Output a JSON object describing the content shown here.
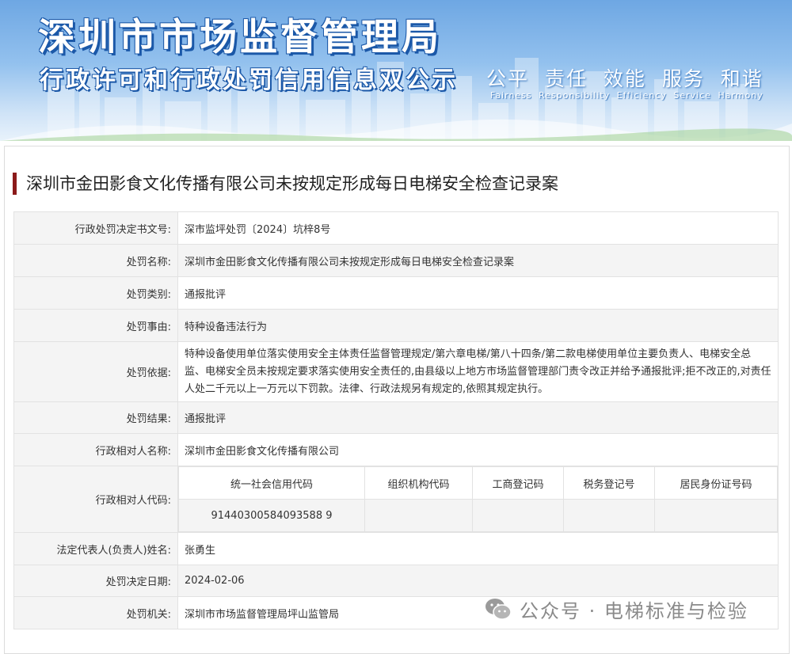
{
  "banner": {
    "title": "深圳市市场监督管理局",
    "subtitle": "行政许可和行政处罚信用信息双公示",
    "values": "公平 责任 效能 服务 和谐",
    "values_en": "Fairness Responsibility Efficiency Service Harmony"
  },
  "case_title": "深圳市金田影食文化传播有限公司未按规定形成每日电梯安全检查记录案",
  "fields": {
    "decision_no": {
      "label": "行政处罚决定书文号:",
      "value": "深市监坪处罚〔2024〕坑梓8号"
    },
    "penalty_name": {
      "label": "处罚名称:",
      "value": "深圳市金田影食文化传播有限公司未按规定形成每日电梯安全检查记录案"
    },
    "penalty_type": {
      "label": "处罚类别:",
      "value": "通报批评"
    },
    "penalty_reason": {
      "label": "处罚事由:",
      "value": "特种设备违法行为"
    },
    "penalty_basis": {
      "label": "处罚依据:",
      "value": "特种设备使用单位落实使用安全主体责任监督管理规定/第六章电梯/第八十四条/第二款电梯使用单位主要负责人、电梯安全总监、电梯安全员未按规定要求落实使用安全责任的,由县级以上地方市场监督管理部门责令改正并给予通报批评;拒不改正的,对责任人处二千元以上一万元以下罚款。法律、行政法规另有规定的,依照其规定执行。"
    },
    "penalty_result": {
      "label": "处罚结果:",
      "value": "通报批评"
    },
    "party_name": {
      "label": "行政相对人名称:",
      "value": "深圳市金田影食文化传播有限公司"
    },
    "party_code": {
      "label": "行政相对人代码:",
      "headers": [
        "统一社会信用代码",
        "组织机构代码",
        "工商登记码",
        "税务登记号",
        "居民身份证号码"
      ],
      "values": [
        "91440300584093588 9",
        "",
        "",
        "",
        ""
      ]
    },
    "legal_rep": {
      "label": "法定代表人(负责人)姓名:",
      "value": "张勇生"
    },
    "decision_date": {
      "label": "处罚决定日期:",
      "value": "2024-02-06"
    },
    "authority": {
      "label": "处罚机关:",
      "value": "深圳市市场监督管理局坪山监管局"
    }
  },
  "watermark": {
    "text": "公众号 · 电梯标准与检验"
  },
  "colors": {
    "accent_bar": "#8b1a1a",
    "banner_blue": "#1b58a8",
    "label_bg": "#f4f4f4",
    "border": "#e2e2e2"
  }
}
